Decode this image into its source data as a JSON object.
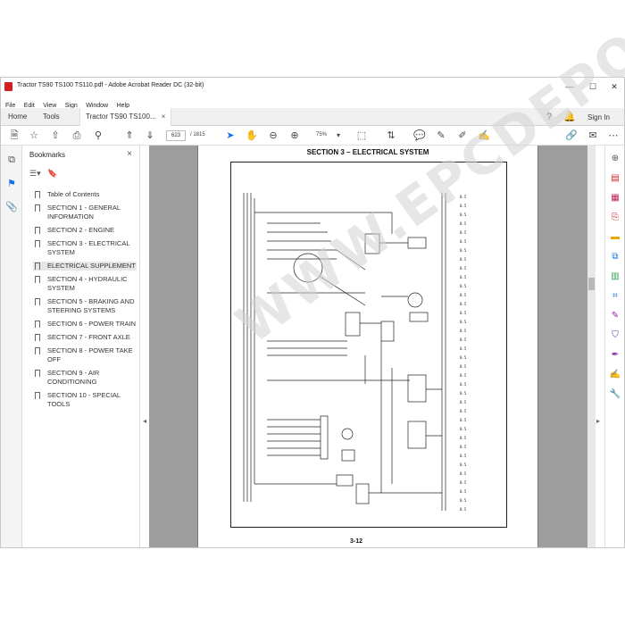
{
  "window": {
    "title": "Tractor TS90 TS100 TS110.pdf - Adobe Acrobat Reader DC (32-bit)",
    "min": "—",
    "max": "☐",
    "close": "✕"
  },
  "menu": [
    "File",
    "Edit",
    "View",
    "Sign",
    "Window",
    "Help"
  ],
  "tabs": {
    "home": "Home",
    "tools": "Tools",
    "doc": "Tractor TS90 TS100...",
    "doc_close": "×",
    "signin": "Sign In"
  },
  "toolbar": {
    "page_current": "623",
    "page_total": "/ 1815",
    "zoom": "75%"
  },
  "bookmarks": {
    "title": "Bookmarks",
    "close": "×",
    "items": [
      "Table of Contents",
      "SECTION 1 - GENERAL INFORMATION",
      "SECTION 2 - ENGINE",
      "SECTION 3 - ELECTRICAL SYSTEM",
      "ELECTRICAL SUPPLEMENT",
      "SECTION 4 - HYDRAULIC SYSTEM",
      "SECTION 5 - BRAKING AND STEERING SYSTEMS",
      "SECTION 6 - POWER TRAIN",
      "SECTION 7 - FRONT AXLE",
      "SECTION 8 - POWER TAKE OFF",
      "SECTION 9 - AIR CONDITIONING",
      "SECTION 10 - SPECIAL TOOLS"
    ],
    "selected_index": 4
  },
  "page": {
    "section_title": "SECTION 3 – ELECTRICAL SYSTEM",
    "page_number": "3-12",
    "watermark": "WWW.EPCDEPO.COM"
  },
  "colors": {
    "accent": "#1473e6",
    "pdf_red": "#d31f1f",
    "doc_bg": "#9d9d9d"
  }
}
